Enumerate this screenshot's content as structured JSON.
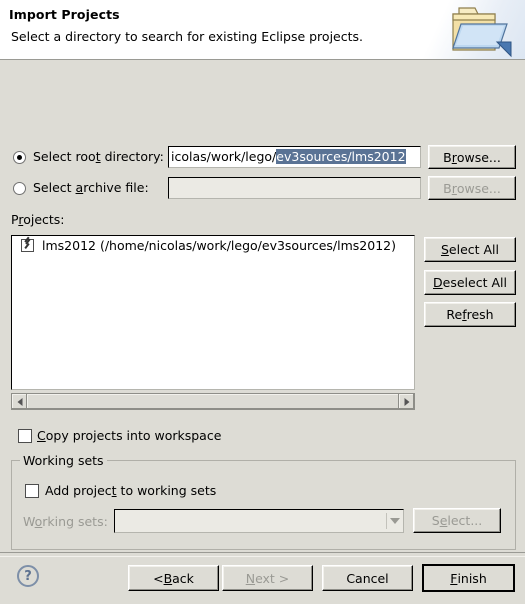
{
  "header": {
    "title": "Import Projects",
    "description": "Select a directory to search for existing Eclipse projects.",
    "icon": "import-folder-icon"
  },
  "source": {
    "root_directory": {
      "label_pre": "Select roo",
      "label_mnemonic": "t",
      "label_post": " directory:",
      "label_full": "Select root directory:",
      "selected": true,
      "value_unselected": "icolas/work/lego/",
      "value_selected": "ev3sources/lms2012",
      "full_value": "icolas/work/lego/ev3sources/lms2012",
      "browse_label_pre": "B",
      "browse_label_mnemonic": "r",
      "browse_label_post": "owse...",
      "browse_label": "Browse...",
      "browse_enabled": true
    },
    "archive_file": {
      "label_pre": "Select ",
      "label_mnemonic": "a",
      "label_post": "rchive file:",
      "label_full": "Select archive file:",
      "selected": false,
      "value": "",
      "enabled": false,
      "browse_label_pre": "B",
      "browse_label_mnemonic": "r",
      "browse_label_post": "owse...",
      "browse_label": "Browse...",
      "browse_enabled": false
    }
  },
  "projects": {
    "label_pre": "P",
    "label_mnemonic": "r",
    "label_post": "ojects:",
    "label_full": "Projects:",
    "items": [
      {
        "name": "lms2012 (/home/nicolas/work/lego/ev3sources/lms2012)",
        "checked": true
      }
    ],
    "buttons": [
      {
        "pre": "",
        "mnemonic": "S",
        "post": "elect All",
        "label": "Select All",
        "enabled": true,
        "name": "select-all-button"
      },
      {
        "pre": "",
        "mnemonic": "D",
        "post": "eselect All",
        "label": "Deselect All",
        "enabled": true,
        "name": "deselect-all-button"
      },
      {
        "pre": "Re",
        "mnemonic": "f",
        "post": "resh",
        "label": "Refresh",
        "enabled": true,
        "name": "refresh-button"
      }
    ],
    "scrollbar": {
      "orientation": "horizontal",
      "left_arrow": "scroll-left-arrow-icon",
      "right_arrow": "scroll-right-arrow-icon"
    }
  },
  "options": {
    "copy_projects": {
      "pre": "",
      "mnemonic": "C",
      "post": "opy projects into workspace",
      "label": "Copy projects into workspace",
      "checked": false
    }
  },
  "working_sets": {
    "group_title": "Working sets",
    "add_project": {
      "pre": "Add projec",
      "mnemonic": "t",
      "post": " to working sets",
      "label": "Add project to working sets",
      "checked": false
    },
    "combo_label_pre": "W",
    "combo_label_mnemonic": "o",
    "combo_label_post": "rking sets:",
    "combo_label": "Working sets:",
    "combo_value": "",
    "combo_enabled": false,
    "select_button": {
      "pre": "S",
      "mnemonic": "e",
      "post": "lect...",
      "label": "Select...",
      "enabled": false
    }
  },
  "footer": {
    "help_icon": "help-question-icon",
    "buttons": [
      {
        "pre": "< ",
        "mnemonic": "B",
        "post": "ack",
        "label": "< Back",
        "enabled": true,
        "default": false,
        "name": "back-button"
      },
      {
        "pre": "",
        "mnemonic": "N",
        "post": "ext >",
        "label": "Next >",
        "enabled": false,
        "default": false,
        "name": "next-button"
      },
      {
        "pre": "Cancel",
        "mnemonic": "",
        "post": "",
        "label": "Cancel",
        "enabled": true,
        "default": false,
        "name": "cancel-button"
      },
      {
        "pre": "",
        "mnemonic": "F",
        "post": "inish",
        "label": "Finish",
        "enabled": true,
        "default": true,
        "name": "finish-button"
      }
    ]
  },
  "colors": {
    "dialog_background": "#dddcd5",
    "header_background": "#ffffff",
    "selection_highlight": "#5a7395",
    "disabled_text": "#9a9a94",
    "field_background": "#ffffff",
    "disabled_field_background": "#ebeae4"
  }
}
